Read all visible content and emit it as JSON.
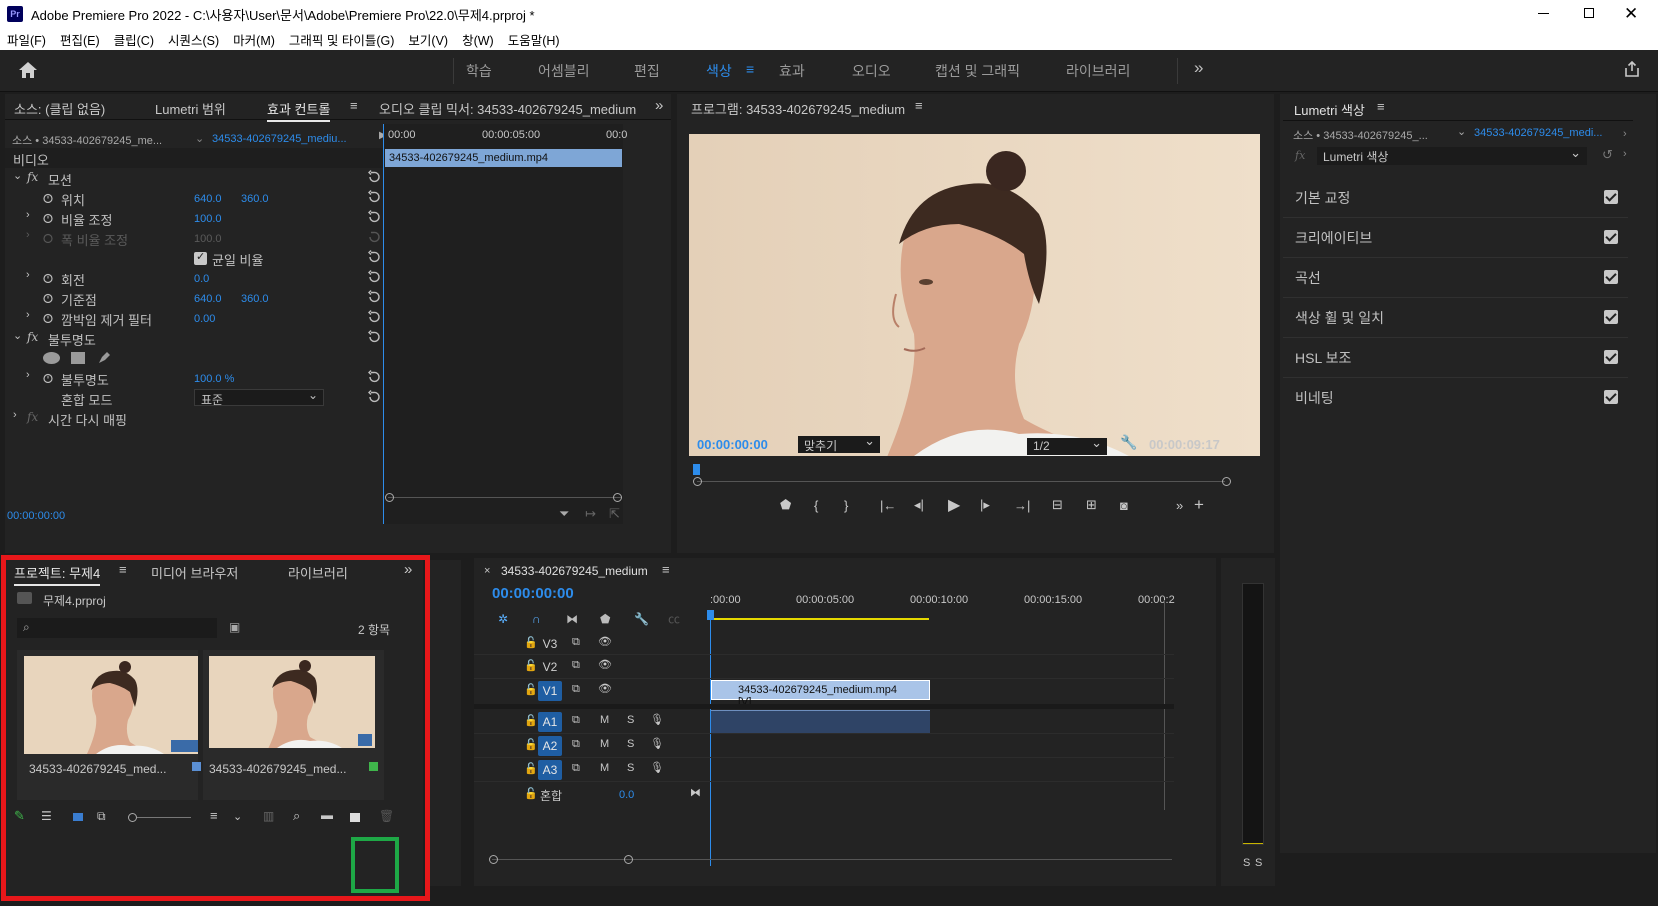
{
  "app": {
    "title": "Adobe Premiere Pro 2022 - C:\\사용자\\User\\문서\\Adobe\\Premiere Pro\\22.0\\무제4.prproj *",
    "icon_text": "Pr"
  },
  "menu": [
    "파일(F)",
    "편집(E)",
    "클립(C)",
    "시퀀스(S)",
    "마커(M)",
    "그래픽 및 타이틀(G)",
    "보기(V)",
    "창(W)",
    "도움말(H)"
  ],
  "workspaces": [
    "학습",
    "어셈블리",
    "편집",
    "색상",
    "효과",
    "오디오",
    "캡션 및 그래픽",
    "라이브러리"
  ],
  "active_workspace": "색상",
  "source_panel": {
    "tabs": [
      "소스: (클립 없음)",
      "Lumetri 범위",
      "효과 컨트롤",
      "오디오 클립 믹서: 34533-402679245_medium"
    ],
    "source_label": "소스 • 34533-402679245_me...",
    "clip_label": "34533-402679245_mediu...",
    "timecodes": [
      "00:00",
      "00:00:05:00",
      "00:0"
    ],
    "clip_bar": "34533-402679245_medium.mp4",
    "section": "비디오",
    "motion": "모션",
    "position": {
      "label": "위치",
      "x": "640.0",
      "y": "360.0"
    },
    "scale": {
      "label": "비율 조정",
      "value": "100.0"
    },
    "scale_width": {
      "label": "폭 비율 조정",
      "value": "100.0"
    },
    "uniform": "균일 비율",
    "rotation": {
      "label": "회전",
      "value": "0.0"
    },
    "anchor": {
      "label": "기준점",
      "x": "640.0",
      "y": "360.0"
    },
    "flicker": {
      "label": "깜박임 제거 필터",
      "value": "0.00"
    },
    "opacity_group": "불투명도",
    "opacity": {
      "label": "불투명도",
      "value": "100.0 %"
    },
    "blend": {
      "label": "혼합 모드",
      "value": "표준"
    },
    "time_remap": "시간 다시 매핑",
    "bottom_time": "00:00:00:00"
  },
  "program": {
    "title": "프로그램: 34533-402679245_medium",
    "timecode": "00:00:00:00",
    "fit": "맞추기",
    "quality": "1/2",
    "duration": "00:00:09:17"
  },
  "lumetri": {
    "title": "Lumetri 색상",
    "source_label": "소스 • 34533-402679245_...",
    "clip_label": "34533-402679245_medi...",
    "effect": "Lumetri 색상",
    "sections": [
      "기본 교정",
      "크리에이티브",
      "곡선",
      "색상 휠 및 일치",
      "HSL 보조",
      "비네팅"
    ]
  },
  "project": {
    "tabs": [
      "프로젝트: 무제4",
      "미디어 브라우저",
      "라이브러리"
    ],
    "file": "무제4.prproj",
    "count": "2 항목",
    "items": [
      {
        "name": "34533-402679245_med...",
        "color": "#5b8fd3"
      },
      {
        "name": "34533-402679245_med...",
        "color": "#3fb54b"
      }
    ]
  },
  "timeline": {
    "title": "34533-402679245_medium",
    "timecode": "00:00:00:00",
    "ruler": [
      ":00:00",
      "00:00:05:00",
      "00:00:10:00",
      "00:00:15:00",
      "00:00:2"
    ],
    "video_tracks": [
      "V3",
      "V2",
      "V1"
    ],
    "audio_tracks": [
      "A1",
      "A2",
      "A3"
    ],
    "clip_label": "34533-402679245_medium.mp4 [V]",
    "mix_label": "혼합",
    "mix_value": "0.0",
    "m": "M",
    "s": "S"
  },
  "meter": {
    "labels": [
      "S",
      "S"
    ]
  },
  "colors": {
    "accent": "#2d8ceb",
    "highlight_red": "#e8171a",
    "highlight_green": "#1ea846"
  }
}
